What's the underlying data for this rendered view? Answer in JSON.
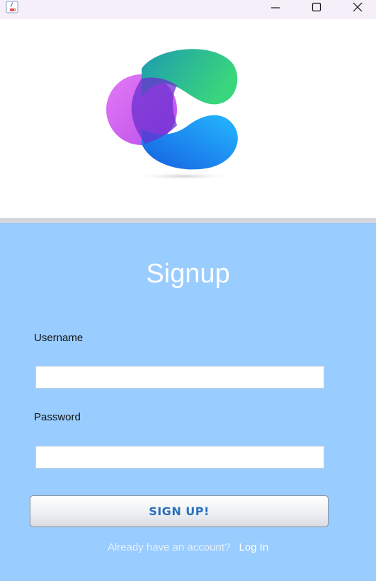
{
  "window": {
    "controls": {
      "minimize_icon": "minimize-icon",
      "maximize_icon": "maximize-icon",
      "close_icon": "close-icon"
    }
  },
  "logo": {
    "colors": {
      "purple": "#c25bf0",
      "green": "#2fd07a",
      "teal": "#1ea6a6",
      "blue": "#1a7ef0"
    }
  },
  "form": {
    "title": "Signup",
    "username_label": "Username",
    "username_value": "",
    "password_label": "Password",
    "password_value": "",
    "submit_label": "SIGN UP!",
    "footer_text": "Already have an account?",
    "footer_link": "Log In"
  },
  "colors": {
    "panel_bg": "#99ccff",
    "button_text": "#2a6fbf"
  }
}
